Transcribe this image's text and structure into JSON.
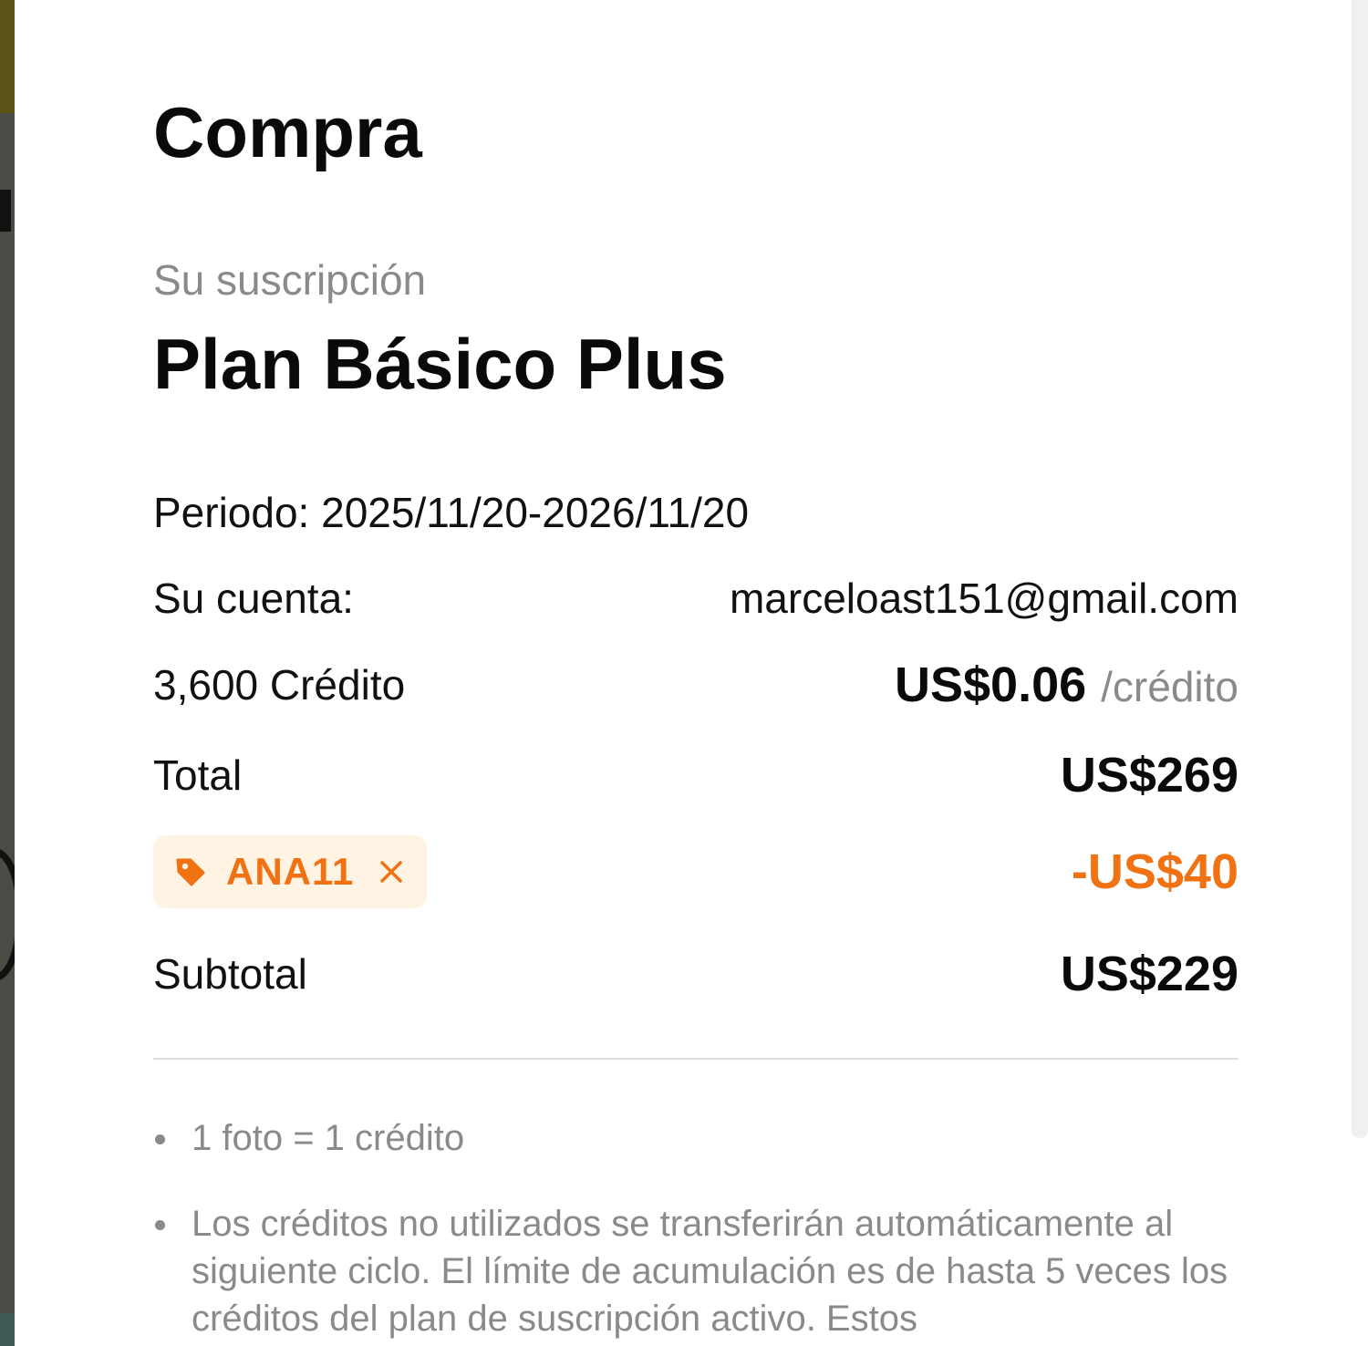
{
  "colors": {
    "accent_orange": "#f07213",
    "coupon_bg": "#fff3e4",
    "muted_text": "#8a8a8a",
    "primary_text": "#0a0a0a"
  },
  "purchase": {
    "title": "Compra",
    "subscription_label": "Su suscripción",
    "plan_name": "Plan Básico Plus"
  },
  "details": {
    "period": "Periodo: 2025/11/20-2026/11/20",
    "account_label": "Su cuenta:",
    "account_email": "marceloast151@gmail.com",
    "credits_label": "3,600 Crédito",
    "unit_price": "US$0.06",
    "unit_suffix": "/crédito",
    "total_label": "Total",
    "total_value": "US$269",
    "coupon_code": "ANA11",
    "coupon_icon": "tag-icon",
    "coupon_remove_icon": "close-icon",
    "discount_value": "-US$40",
    "subtotal_label": "Subtotal",
    "subtotal_value": "US$229"
  },
  "notes": [
    "1 foto = 1 crédito",
    "Los créditos no utilizados se transferirán automáticamente al siguiente ciclo. El límite de acumulación es de hasta 5 veces los créditos del plan de suscripción activo. Estos"
  ]
}
